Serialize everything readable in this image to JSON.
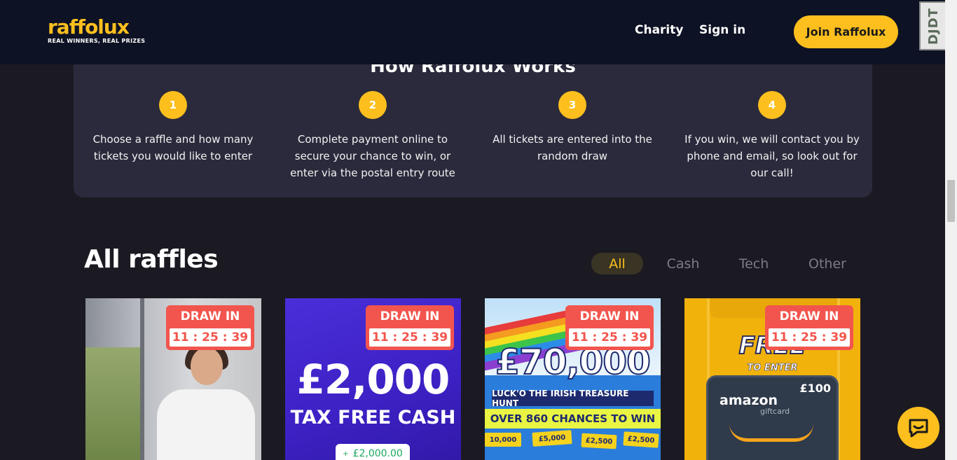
{
  "header": {
    "logo_text": "raffolux",
    "logo_tagline": "REAL WINNERS, REAL PRIZES",
    "nav_charity": "Charity",
    "nav_signin": "Sign in",
    "join_label": "Join Raffolux",
    "extension_badge": "DJDT"
  },
  "how_it_works": {
    "title": "How Raffolux Works",
    "steps": [
      {
        "num": "1",
        "text": "Choose a raffle and how many tickets you would like to enter"
      },
      {
        "num": "2",
        "text": "Complete payment online to secure your chance to win, or enter via the postal entry route"
      },
      {
        "num": "3",
        "text": "All tickets are entered into the random draw"
      },
      {
        "num": "4",
        "text": "If you win, we will contact you by phone and email, so look out for our call!"
      }
    ]
  },
  "raffles": {
    "title": "All raffles",
    "filters": [
      {
        "label": "All",
        "active": true
      },
      {
        "label": "Cash",
        "active": false
      },
      {
        "label": "Tech",
        "active": false
      },
      {
        "label": "Other",
        "active": false
      }
    ],
    "cards": [
      {
        "draw_label": "DRAW IN",
        "timer": "11 : 25 : 39"
      },
      {
        "draw_label": "DRAW IN",
        "timer": "11 : 25 : 39",
        "amount": "£2,000",
        "subtitle": "TAX FREE CASH",
        "pill": "£2,000.00"
      },
      {
        "draw_label": "DRAW IN",
        "timer": "11 : 25 : 39",
        "amount": "£70,000",
        "banner1": "LUCK'O THE IRISH TREASURE HUNT",
        "banner2": "OVER 860 CHANCES TO WIN",
        "tickets": [
          "10,000",
          "£5,000",
          "£2,500",
          "£2,500"
        ]
      },
      {
        "draw_label": "DRAW IN",
        "timer": "11 : 25 : 39",
        "free": "FREE",
        "to_enter": "TO ENTER",
        "gift_value": "£100",
        "gift_brand": "amazon",
        "gift_sub": "giftcard"
      }
    ]
  },
  "colors": {
    "accent": "#fcbf1e",
    "header_bg": "#0d1224",
    "page_bg": "#1b1a22",
    "panel_bg": "#2a2a3c",
    "draw_red": "#f2554d"
  },
  "icons": {
    "chat": "chat-bubble-icon"
  }
}
